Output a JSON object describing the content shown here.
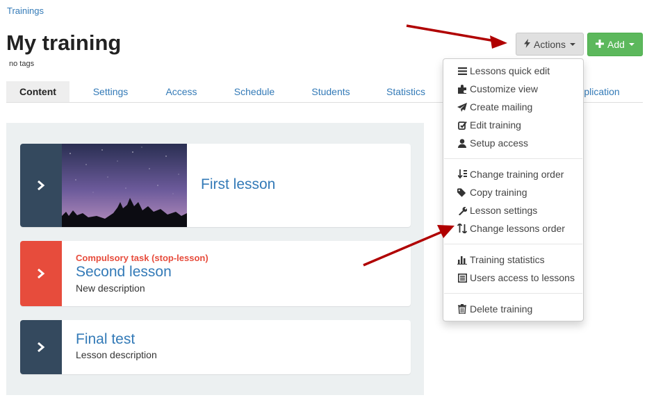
{
  "breadcrumb": "Trainings",
  "page": {
    "title": "My training",
    "tags": "no tags"
  },
  "toolbar": {
    "actions_label": "Actions",
    "add_label": "Add"
  },
  "tabs": [
    "Content",
    "Settings",
    "Access",
    "Schedule",
    "Students",
    "Statistics",
    "plication"
  ],
  "lessons": [
    {
      "title": "First lesson"
    },
    {
      "stop_label": "Compulsory task (stop-lesson)",
      "title": "Second lesson",
      "description": "New description"
    },
    {
      "title": "Final test",
      "description": "Lesson description"
    }
  ],
  "menu": {
    "group1": [
      "Lessons quick edit",
      "Customize view",
      "Create mailing",
      "Edit training",
      "Setup access"
    ],
    "group2": [
      "Change training order",
      "Copy training",
      "Lesson settings",
      "Change lessons order"
    ],
    "group3": [
      "Training statistics",
      "Users access to lessons"
    ],
    "group4": [
      "Delete training"
    ]
  },
  "colors": {
    "accent": "#337ab7",
    "add_green": "#5cb85c",
    "stop_red": "#e74c3c",
    "card_dark": "#34495e",
    "annotation_arrow": "#b00000"
  },
  "icons": {
    "actions": "bolt-icon",
    "add": "plus-icon",
    "lesson_open": "chevron-right-icon",
    "menu": [
      "list-icon",
      "puzzle-icon",
      "paper-plane-icon",
      "edit-icon",
      "user-icon",
      "sort-order-icon",
      "tags-icon",
      "wrench-icon",
      "sort-arrows-icon",
      "bar-chart-icon",
      "list-alt-icon",
      "trash-icon"
    ]
  }
}
